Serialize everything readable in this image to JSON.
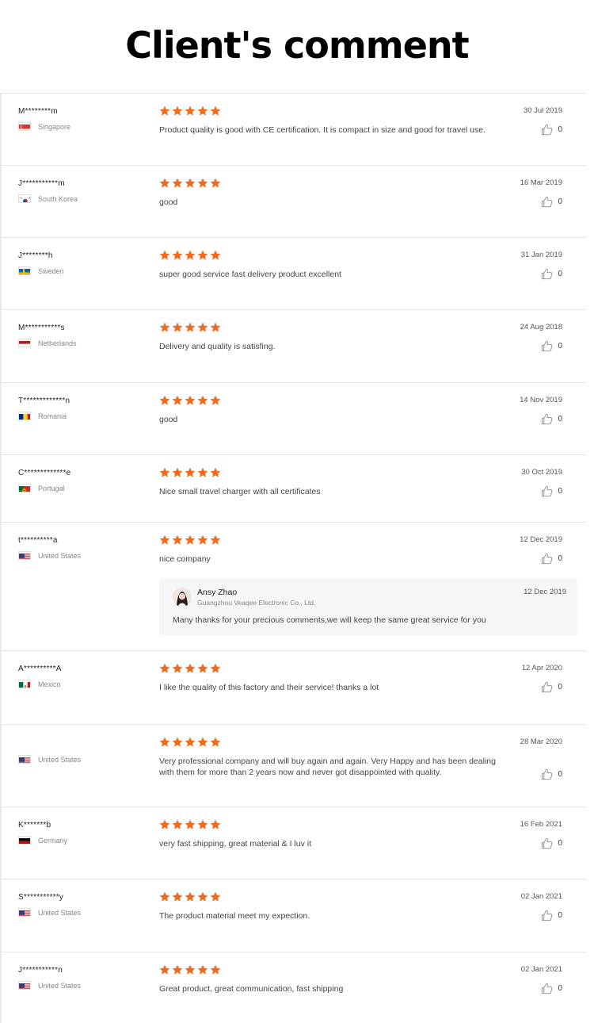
{
  "page": {
    "title": "Client's comment"
  },
  "colors": {
    "star": "#f26b1d",
    "text": "#444444",
    "muted": "#888888",
    "divider": "#e6e6e6"
  },
  "reviews": [
    {
      "name": "M********m",
      "country": "Singapore",
      "flag": "singapore-flag-icon",
      "rating": 5,
      "comment": "Product quality is good with CE certification. It is compact in size and good for travel use.",
      "date": "30 Jul 2019",
      "likes": "0"
    },
    {
      "name": "J***********m",
      "country": "South Korea",
      "flag": "south-korea-flag-icon",
      "rating": 5,
      "comment": "good",
      "date": "16 Mar 2019",
      "likes": "0"
    },
    {
      "name": "J********h",
      "country": "Sweden",
      "flag": "sweden-flag-icon",
      "rating": 5,
      "comment": "super good service fast delivery product excellent",
      "date": "31 Jan 2019",
      "likes": "0"
    },
    {
      "name": "M***********s",
      "country": "Netherlands",
      "flag": "netherlands-flag-icon",
      "rating": 5,
      "comment": "Delivery and quality is satisfing.",
      "date": "24 Aug 2018",
      "likes": "0"
    },
    {
      "name": "T*************n",
      "country": "Romania",
      "flag": "romania-flag-icon",
      "rating": 5,
      "comment": "good",
      "date": "14 Nov 2019",
      "likes": "0"
    },
    {
      "name": "C*************e",
      "country": "Portugal",
      "flag": "portugal-flag-icon",
      "rating": 5,
      "comment": "Nice small travel charger with all certificates",
      "date": "30 Oct 2019",
      "likes": "0"
    },
    {
      "name": "t**********a",
      "country": "United States",
      "flag": "us-flag-icon",
      "rating": 5,
      "comment": "nice company",
      "date": "12 Dec 2019",
      "likes": "0",
      "reply": {
        "name": "Ansy Zhao",
        "company": "Guangzhou Veaqee Electronic Co., Ltd.",
        "date": "12 Dec 2019",
        "text": "Many thanks for your precious comments,we will keep the same great service for you"
      }
    },
    {
      "name": "A**********A",
      "country": "Mexico",
      "flag": "mexico-flag-icon",
      "rating": 5,
      "comment": "I like the quality of this factory and their service! thanks a lot",
      "date": "12 Apr 2020",
      "likes": "0"
    },
    {
      "name": "",
      "country": "United States",
      "flag": "us-flag-icon",
      "rating": 5,
      "comment": "Very professional company and will buy again and again. Very Happy and has been dealing with them for more than 2 years now and never got disappointed with quality.",
      "date": "28 Mar 2020",
      "likes": "0"
    },
    {
      "name": "K*******b",
      "country": "Germany",
      "flag": "germany-flag-icon",
      "rating": 5,
      "comment": "very fast shipping, great material & I luv it",
      "date": "16 Feb 2021",
      "likes": "0"
    },
    {
      "name": "S***********y",
      "country": "United States",
      "flag": "us-flag-icon",
      "rating": 5,
      "comment": "The product material meet my expection.",
      "date": "02 Jan 2021",
      "likes": "0"
    },
    {
      "name": "J***********n",
      "country": "United States",
      "flag": "us-flag-icon",
      "rating": 5,
      "comment": "Great product, great communication, fast shipping",
      "date": "02 Jan 2021",
      "likes": "0"
    }
  ]
}
